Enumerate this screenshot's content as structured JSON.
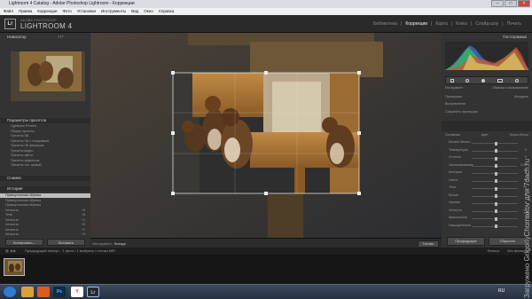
{
  "window": {
    "title": "Lightroom 4 Catalog - Adobe Photoshop Lightroom - Коррекции",
    "controls": [
      "–",
      "□",
      "×"
    ]
  },
  "menu": [
    "Файл",
    "Правка",
    "Коррекции",
    "Фото",
    "Установки",
    "Инструменты",
    "Вид",
    "Окно",
    "Справка"
  ],
  "brand": {
    "logo": "Lr",
    "sub": "ADOBE PHOTOSHOP",
    "name": "LIGHTROOM 4"
  },
  "modules": [
    {
      "label": "Библиотека",
      "active": false
    },
    {
      "label": "Коррекции",
      "active": true
    },
    {
      "label": "Карта",
      "active": false
    },
    {
      "label": "Книга",
      "active": false
    },
    {
      "label": "Слайд-шоу",
      "active": false
    },
    {
      "label": "Печать",
      "active": false
    }
  ],
  "left_panel": {
    "navigator": {
      "title": "Навигатор",
      "zoom": "FIT"
    },
    "presets": {
      "title": "Параметры пресетов",
      "items": [
        "Lightroom Presets",
        "Общие пресеты",
        "Пресеты ЧБ",
        "Пресеты ЧБ с тонировкой",
        "Пресеты ЧБ фильтров",
        "Пресеты видео",
        "Пресеты цвета",
        "Пресеты эффектов",
        "Пресеты тон. кривой"
      ]
    },
    "snapshots": {
      "title": "Снимки"
    },
    "history": {
      "title": "История",
      "items": [
        {
          "label": "Прямоугольная обрезка",
          "value": "",
          "selected": true
        },
        {
          "label": "Прямоугольная обрезка",
          "value": "",
          "selected": false
        },
        {
          "label": "Прямоугольная обрезка",
          "value": "",
          "selected": false
        },
        {
          "label": "Четкость",
          "value": "+5",
          "selected": false
        },
        {
          "label": "Тени",
          "value": "+6",
          "selected": false
        },
        {
          "label": "Четкость",
          "value": "+1",
          "selected": false
        },
        {
          "label": "Четкость",
          "value": "+5",
          "selected": false
        },
        {
          "label": "Четкость",
          "value": "+1",
          "selected": false
        },
        {
          "label": "Четкость",
          "value": "+3",
          "selected": false
        }
      ]
    },
    "buttons": {
      "copy": "Копировать...",
      "paste": "Вставить"
    }
  },
  "toolbar": {
    "tool_label": "Инструмент:",
    "tool_value": "Всегда",
    "done": "Готово"
  },
  "filmstrip": {
    "nav_text": "Предыдущий импорт : 1 фото / 1 выбрано / птички.NEF",
    "filter_label": "Фильтр:",
    "filter_value": "Без фильтра"
  },
  "right_panel": {
    "histogram_title": "Гистограмма",
    "crop_label": "Инструмент:",
    "crop_value": "Обрезка и выпрямление",
    "aspect_label": "Пропорции:",
    "aspect_value": "Исходное",
    "straighten_label": "Выпрямление",
    "constrain_label": "Сохранять пропорции",
    "basic_label": "Основные",
    "treatment_label": "Цвет",
    "bw_label": "Черно-белое",
    "sliders": [
      {
        "label": "Баланс белого",
        "value": ""
      },
      {
        "label": "Температура",
        "value": "0"
      },
      {
        "label": "Оттенок",
        "value": "0"
      },
      {
        "label": "Экспонирование",
        "value": "0.00"
      },
      {
        "label": "Контраст",
        "value": "0"
      },
      {
        "label": "Света",
        "value": "0"
      },
      {
        "label": "Тени",
        "value": "+6"
      },
      {
        "label": "Белые",
        "value": "0"
      },
      {
        "label": "Черные",
        "value": "0"
      },
      {
        "label": "Четкость",
        "value": "+5"
      },
      {
        "label": "Красочность",
        "value": "0"
      },
      {
        "label": "Насыщенность",
        "value": "0"
      }
    ],
    "buttons": {
      "prev": "Предыдущие",
      "reset": "Сбросить"
    }
  },
  "taskbar": {
    "apps": [
      {
        "name": "start-icon",
        "glyph": "",
        "color": "#2f7bd1"
      },
      {
        "name": "explorer-icon",
        "glyph": "",
        "color": "#d9a13a"
      },
      {
        "name": "media-icon",
        "glyph": "",
        "color": "#e05a1c"
      },
      {
        "name": "photoshop-icon",
        "glyph": "Ps",
        "color": "#0f2a44"
      },
      {
        "name": "yandex-icon",
        "glyph": "Y",
        "color": "#ffffff"
      },
      {
        "name": "lightroom-icon",
        "glyph": "Lr",
        "color": "#2a2a2a"
      }
    ],
    "lang": "RU"
  },
  "watermark": "Загружено GrigoriyChumakov для 7dach.ru"
}
